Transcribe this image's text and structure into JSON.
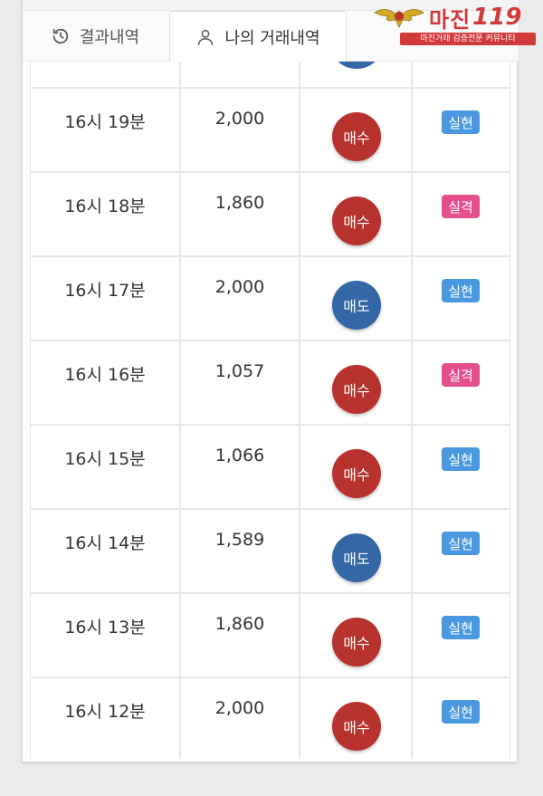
{
  "tabs": {
    "results_label": "결과내역",
    "my_trades_label": "나의 거래내역"
  },
  "logo": {
    "name": "마진",
    "number": "119",
    "tagline": "마진거래 검증전문 커뮤니티"
  },
  "trades": [
    {
      "time": "16시 19분",
      "amount": "2,000",
      "side": "매수",
      "side_type": "buy",
      "result": "실현",
      "result_type": "hit"
    },
    {
      "time": "16시 18분",
      "amount": "1,860",
      "side": "매수",
      "side_type": "buy",
      "result": "실격",
      "result_type": "miss"
    },
    {
      "time": "16시 17분",
      "amount": "2,000",
      "side": "매도",
      "side_type": "sell",
      "result": "실현",
      "result_type": "hit"
    },
    {
      "time": "16시 16분",
      "amount": "1,057",
      "side": "매수",
      "side_type": "buy",
      "result": "실격",
      "result_type": "miss"
    },
    {
      "time": "16시 15분",
      "amount": "1,066",
      "side": "매수",
      "side_type": "buy",
      "result": "실현",
      "result_type": "hit"
    },
    {
      "time": "16시 14분",
      "amount": "1,589",
      "side": "매도",
      "side_type": "sell",
      "result": "실현",
      "result_type": "hit"
    },
    {
      "time": "16시 13분",
      "amount": "1,860",
      "side": "매수",
      "side_type": "buy",
      "result": "실현",
      "result_type": "hit"
    },
    {
      "time": "16시 12분",
      "amount": "2,000",
      "side": "매수",
      "side_type": "buy",
      "result": "실현",
      "result_type": "hit"
    }
  ],
  "colors": {
    "buy": "#b8332e",
    "sell": "#3467a6",
    "hit": "#4a98e0",
    "miss": "#e54f8c",
    "brand": "#d23a3a"
  }
}
